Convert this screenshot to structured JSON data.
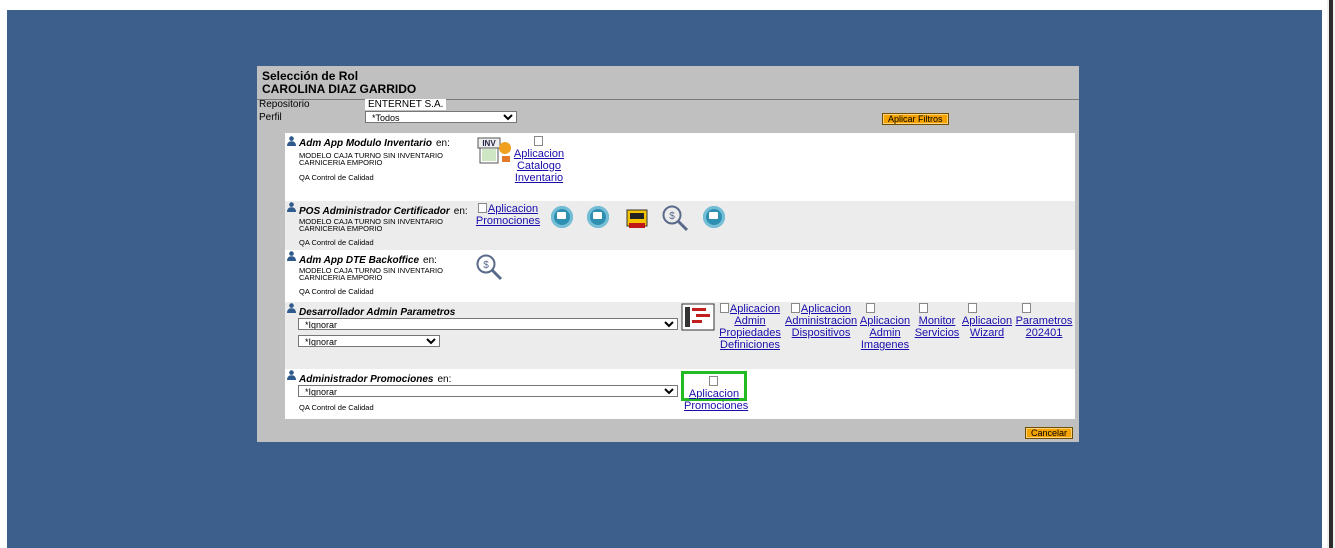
{
  "header": {
    "title": "Selección de Rol",
    "user": "CAROLINA DIAZ GARRIDO"
  },
  "filters": {
    "repositorio_label": "Repositorio",
    "repositorio_value": "ENTERNET S.A.",
    "perfil_label": "Perfil",
    "perfil_value": "*Todos",
    "apply_label": "Aplicar Filtros"
  },
  "roles": [
    {
      "name": "Adm App Modulo Inventario",
      "en": "en:",
      "location_1": "MODELO CAJA TURNO SIN INVENTARIO",
      "location_2": "CARNICERIA EMPORIO",
      "area": "QA Control de Calidad",
      "apps": [
        {
          "icon": "inventory-icon"
        },
        {
          "label": "Aplicacion Catalogo Inventario"
        }
      ]
    },
    {
      "name": "POS Administrador Certificador",
      "en": "en:",
      "location_1": "MODELO CAJA TURNO SIN INVENTARIO",
      "location_2": "CARNICERIA EMPORIO",
      "area": "QA Control de Calidad",
      "apps": [
        {
          "label": "Aplicacion Promociones"
        },
        {
          "icon": "monitor-icon"
        },
        {
          "icon": "monitor-icon"
        },
        {
          "icon": "cash-register-icon"
        },
        {
          "icon": "money-search-icon"
        },
        {
          "icon": "monitor-icon"
        }
      ]
    },
    {
      "name": "Adm App DTE Backoffice",
      "en": "en:",
      "location_1": "MODELO CAJA TURNO SIN INVENTARIO",
      "location_2": "CARNICERIA EMPORIO",
      "area": "QA Control de Calidad",
      "apps": [
        {
          "icon": "money-search-icon"
        }
      ]
    },
    {
      "name": "Desarrollador Admin Parametros",
      "select_1": "*Ignorar",
      "select_2": "*Ignorar",
      "apps": [
        {
          "icon": "gantt-icon"
        },
        {
          "label": "Aplicacion Admin Propiedades Definiciones"
        },
        {
          "label": "Aplicacion Administracion Dispositivos"
        },
        {
          "label": "Aplicacion Admin Imagenes"
        },
        {
          "label": "Monitor Servicios"
        },
        {
          "label": "Aplicacion Wizard"
        },
        {
          "label": "Parametros 202401"
        }
      ]
    },
    {
      "name": "Administrador Promociones",
      "en": "en:",
      "select_1": "*Ignorar",
      "area": "QA Control de Calidad",
      "apps": [
        {
          "label": "Aplicacion Promociones",
          "highlighted": true
        }
      ]
    }
  ],
  "cancel_label": "Cancelar",
  "colors": {
    "background": "#3d5f8c",
    "panel": "#c0c0c0",
    "button": "#f4a300",
    "highlight": "#22bb22",
    "link": "#1a0dab"
  }
}
